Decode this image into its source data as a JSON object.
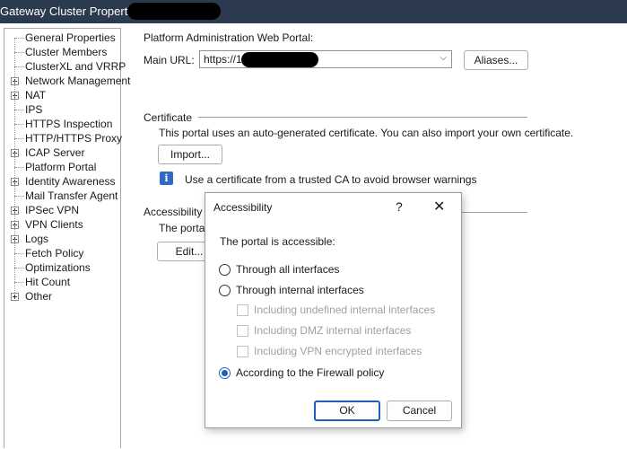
{
  "window": {
    "title": "Gateway Cluster Properties"
  },
  "tree": {
    "items": [
      {
        "label": "General Properties",
        "expandable": false
      },
      {
        "label": "Cluster Members",
        "expandable": false
      },
      {
        "label": "ClusterXL and VRRP",
        "expandable": false
      },
      {
        "label": "Network Management",
        "expandable": true
      },
      {
        "label": "NAT",
        "expandable": true
      },
      {
        "label": "IPS",
        "expandable": false
      },
      {
        "label": "HTTPS Inspection",
        "expandable": false
      },
      {
        "label": "HTTP/HTTPS Proxy",
        "expandable": false
      },
      {
        "label": "ICAP Server",
        "expandable": true
      },
      {
        "label": "Platform Portal",
        "expandable": false,
        "selected": true
      },
      {
        "label": "Identity Awareness",
        "expandable": true
      },
      {
        "label": "Mail Transfer Agent",
        "expandable": false
      },
      {
        "label": "IPSec VPN",
        "expandable": true
      },
      {
        "label": "VPN Clients",
        "expandable": true
      },
      {
        "label": "Logs",
        "expandable": true
      },
      {
        "label": "Fetch Policy",
        "expandable": false
      },
      {
        "label": "Optimizations",
        "expandable": false
      },
      {
        "label": "Hit Count",
        "expandable": false
      },
      {
        "label": "Other",
        "expandable": true
      }
    ]
  },
  "main": {
    "portal_heading": "Platform Administration Web Portal:",
    "main_url_label": "Main URL:",
    "main_url_value": "https://10",
    "aliases_button": "Aliases...",
    "certificate_heading": "Certificate",
    "certificate_text": "This portal uses an auto-generated certificate. You can also import your own certificate.",
    "import_button": "Import...",
    "info_text": "Use a certificate from a trusted CA to avoid browser warnings",
    "accessibility_heading": "Accessibility",
    "accessibility_text": "The portal i",
    "edit_button": "Edit..."
  },
  "dialog": {
    "title": "Accessibility",
    "help": "?",
    "close": "✕",
    "prompt": "The portal is accessible:",
    "options": [
      {
        "label": "Through all interfaces",
        "checked": false
      },
      {
        "label": "Through internal interfaces",
        "checked": false
      },
      {
        "label": "According to the Firewall policy",
        "checked": true
      }
    ],
    "sub_options": [
      {
        "label": "Including undefined internal interfaces",
        "enabled": false
      },
      {
        "label": "Including DMZ internal interfaces",
        "enabled": false
      },
      {
        "label": "Including VPN encrypted interfaces",
        "enabled": false
      }
    ],
    "ok_button": "OK",
    "cancel_button": "Cancel"
  },
  "colors": {
    "titlebar": "#2b3a4e",
    "accent": "#1d5fbf",
    "info_icon": "#2d6bc7"
  }
}
